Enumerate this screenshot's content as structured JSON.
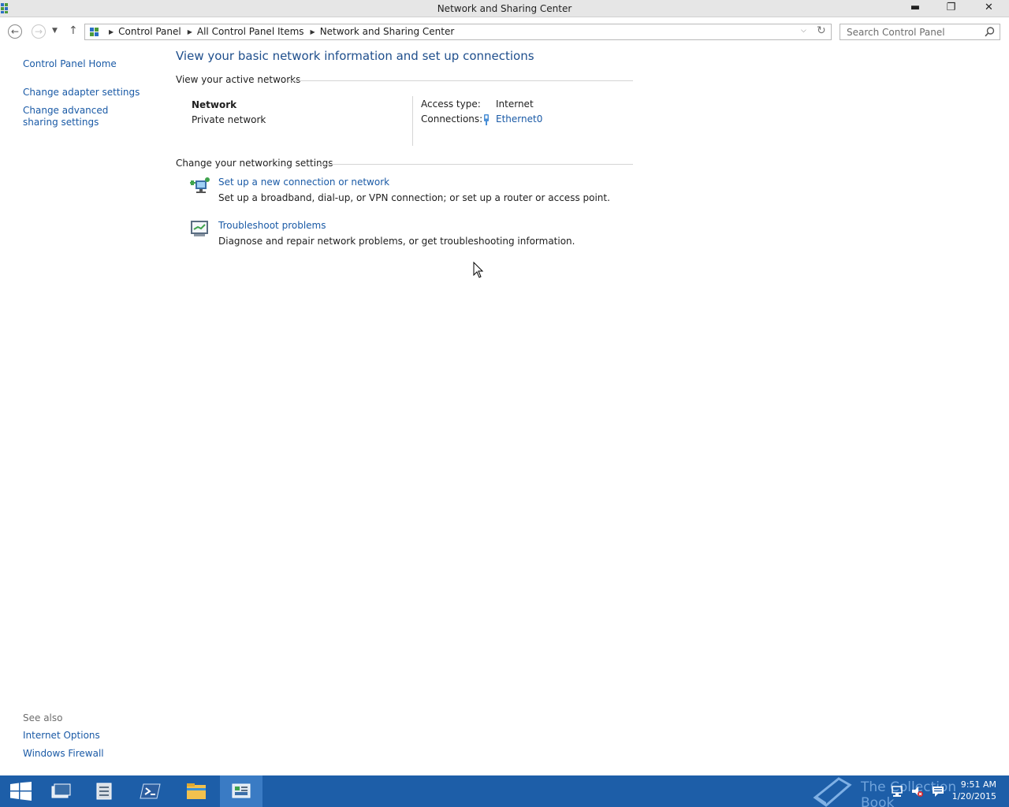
{
  "window": {
    "title": "Network and Sharing Center",
    "minimize_label": "▬",
    "maximize_label": "❐",
    "close_label": "✕"
  },
  "address_bar": {
    "breadcrumbs": [
      "Control Panel",
      "All Control Panel Items",
      "Network and Sharing Center"
    ],
    "search_placeholder": "Search Control Panel"
  },
  "left_pane": {
    "home": "Control Panel Home",
    "links": [
      "Change adapter settings",
      "Change advanced sharing settings"
    ],
    "see_also_title": "See also",
    "see_also": [
      "Internet Options",
      "Windows Firewall"
    ]
  },
  "main": {
    "title": "View your basic network information and set up connections",
    "active_networks_heading": "View your active networks",
    "network": {
      "name": "Network",
      "type": "Private network",
      "access_type_label": "Access type:",
      "access_type_value": "Internet",
      "connections_label": "Connections:",
      "connection_name": "Ethernet0"
    },
    "settings_heading": "Change your networking settings",
    "tasks": [
      {
        "link": "Set up a new connection or network",
        "description": "Set up a broadband, dial-up, or VPN connection; or set up a router or access point."
      },
      {
        "link": "Troubleshoot problems",
        "description": "Diagnose and repair network problems, or get troubleshooting information."
      }
    ]
  },
  "taskbar": {
    "watermark": "The Collection Book",
    "time": "9:51 AM",
    "date": "1/20/2015"
  },
  "colors": {
    "link": "#1a5aa6",
    "title": "#1e4e8c",
    "taskbar": "#1d5ea8"
  }
}
